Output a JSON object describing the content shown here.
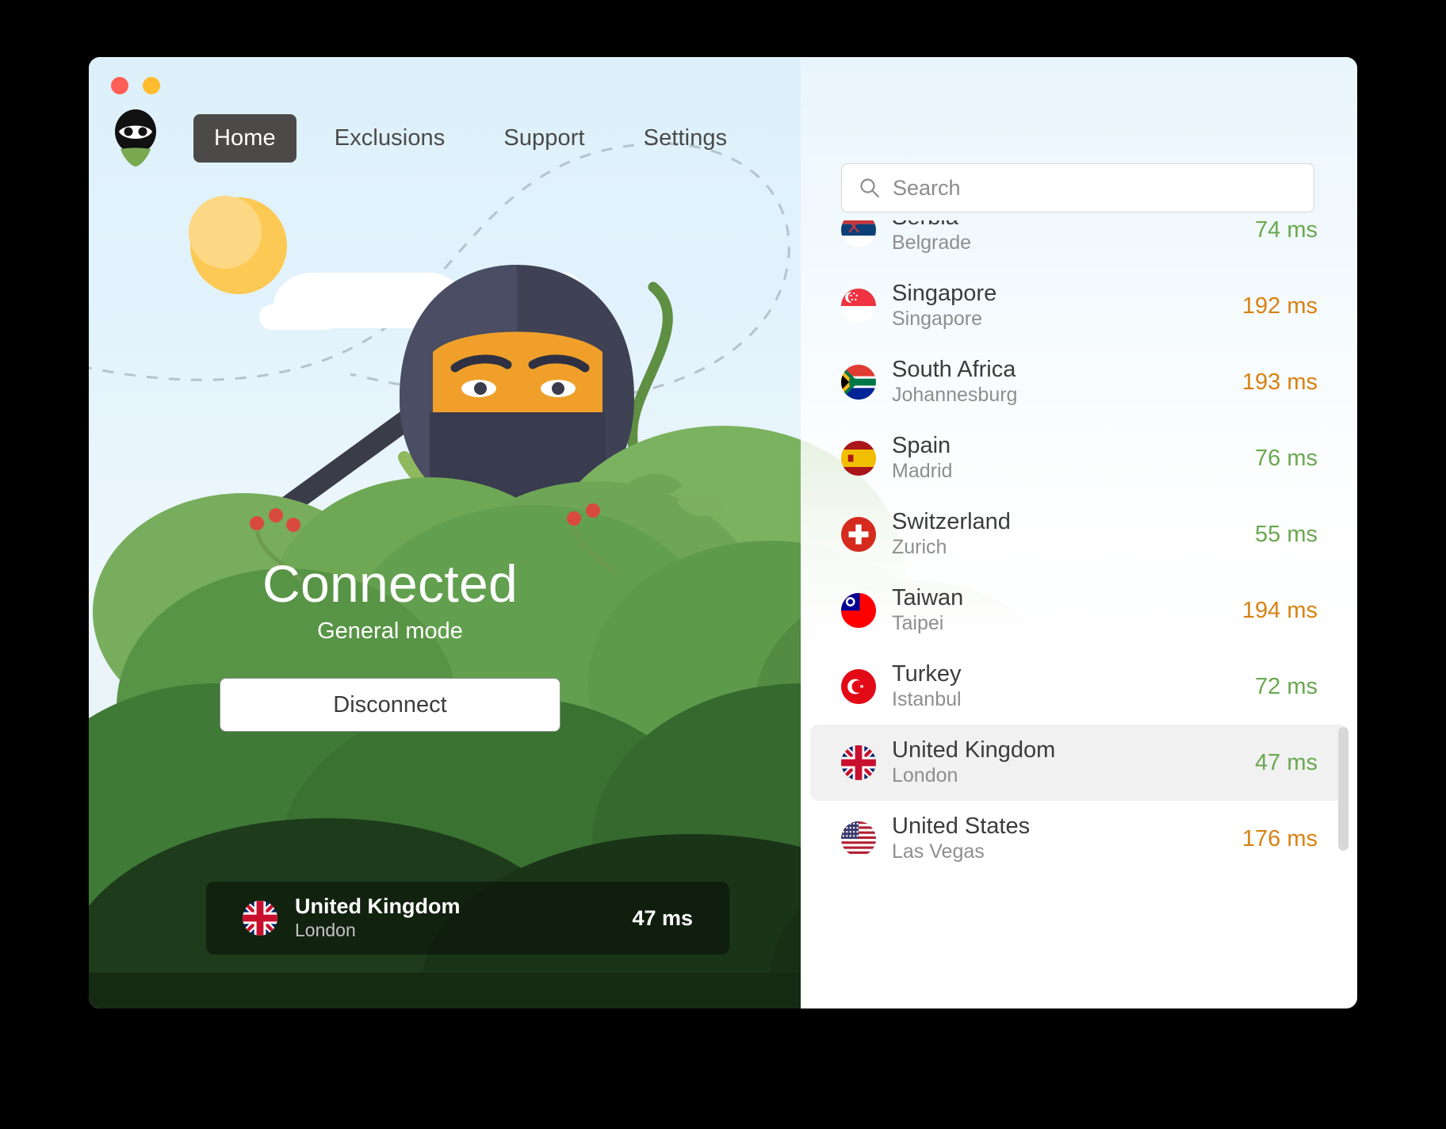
{
  "window": {
    "traffic_lights": [
      {
        "name": "close",
        "color": "#ff5f56"
      },
      {
        "name": "minimize",
        "color": "#febc2e"
      }
    ]
  },
  "nav": {
    "logo_name": "ninja-logo",
    "tabs": [
      {
        "id": "home",
        "label": "Home",
        "active": true
      },
      {
        "id": "exclusions",
        "label": "Exclusions",
        "active": false
      },
      {
        "id": "support",
        "label": "Support",
        "active": false
      },
      {
        "id": "settings",
        "label": "Settings",
        "active": false
      }
    ]
  },
  "status": {
    "headline": "Connected",
    "mode": "General mode",
    "button_label": "Disconnect"
  },
  "current_location": {
    "country": "United Kingdom",
    "city": "London",
    "ping": "47 ms",
    "flag": "gb"
  },
  "search": {
    "placeholder": "Search",
    "value": "",
    "icon": "search-icon"
  },
  "server_list": {
    "scroll_position": "middle",
    "items": [
      {
        "country": "Serbia",
        "city": "Belgrade",
        "ping": "74 ms",
        "latency_class": "green",
        "flag": "rs",
        "selected": false,
        "clipped_top": true
      },
      {
        "country": "Singapore",
        "city": "Singapore",
        "ping": "192 ms",
        "latency_class": "orange",
        "flag": "sg",
        "selected": false
      },
      {
        "country": "South Africa",
        "city": "Johannesburg",
        "ping": "193 ms",
        "latency_class": "orange",
        "flag": "za",
        "selected": false
      },
      {
        "country": "Spain",
        "city": "Madrid",
        "ping": "76 ms",
        "latency_class": "green",
        "flag": "es",
        "selected": false
      },
      {
        "country": "Switzerland",
        "city": "Zurich",
        "ping": "55 ms",
        "latency_class": "green",
        "flag": "ch",
        "selected": false
      },
      {
        "country": "Taiwan",
        "city": "Taipei",
        "ping": "194 ms",
        "latency_class": "orange",
        "flag": "tw",
        "selected": false
      },
      {
        "country": "Turkey",
        "city": "Istanbul",
        "ping": "72 ms",
        "latency_class": "green",
        "flag": "tr",
        "selected": false
      },
      {
        "country": "United Kingdom",
        "city": "London",
        "ping": "47 ms",
        "latency_class": "green",
        "flag": "gb",
        "selected": true
      },
      {
        "country": "United States",
        "city": "Las Vegas",
        "ping": "176 ms",
        "latency_class": "orange",
        "flag": "us",
        "selected": false
      }
    ]
  },
  "colors": {
    "accent_green": "#6aa84f",
    "accent_orange": "#d98112",
    "active_tab_bg": "#4c4a48",
    "sky": "#ddf0fa",
    "selected_row": "#f1f1f1"
  }
}
